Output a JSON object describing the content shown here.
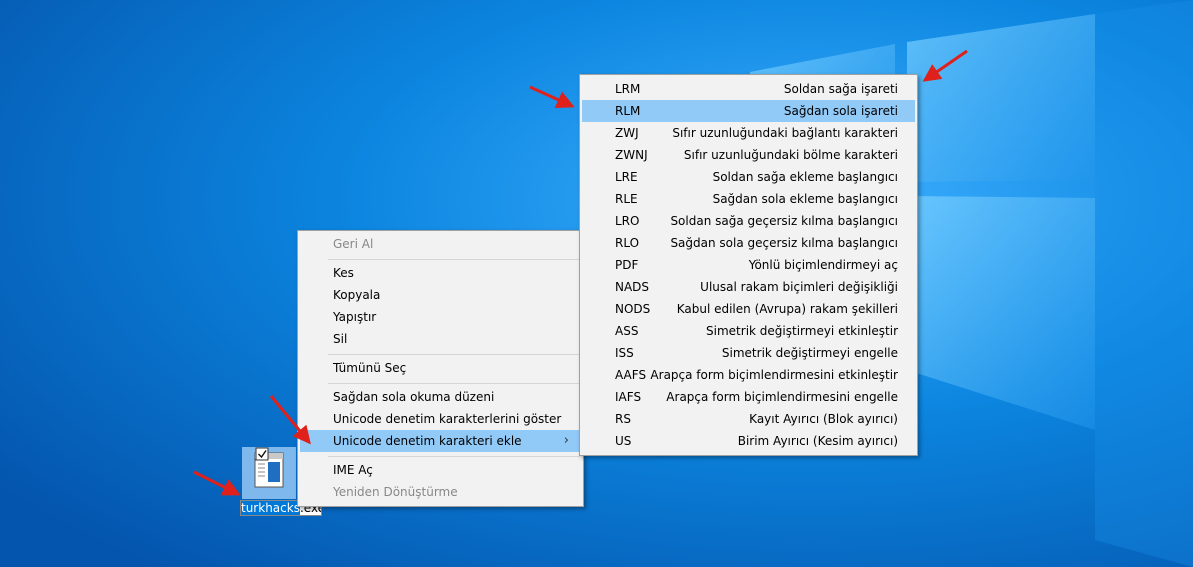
{
  "context_menu": {
    "undo": "Geri Al",
    "cut": "Kes",
    "copy": "Kopyala",
    "paste": "Yapıştır",
    "delete": "Sil",
    "select_all": "Tümünü Seç",
    "rtl_reading": "Sağdan sola okuma düzeni",
    "show_unicode": "Unicode denetim karakterlerini göster",
    "insert_unicode": "Unicode denetim karakteri ekle",
    "insert_unicode_arrow": "›",
    "ime_open": "IME Aç",
    "reconversion": "Yeniden Dönüştürme"
  },
  "submenu": {
    "items": [
      {
        "code": "LRM",
        "desc": "Soldan sağa işareti"
      },
      {
        "code": "RLM",
        "desc": "Sağdan sola işareti"
      },
      {
        "code": "ZWJ",
        "desc": "Sıfır uzunluğundaki bağlantı karakteri"
      },
      {
        "code": "ZWNJ",
        "desc": "Sıfır uzunluğundaki bölme karakteri"
      },
      {
        "code": "LRE",
        "desc": "Soldan sağa ekleme başlangıcı"
      },
      {
        "code": "RLE",
        "desc": "Sağdan sola ekleme başlangıcı"
      },
      {
        "code": "LRO",
        "desc": "Soldan sağa geçersiz kılma başlangıcı"
      },
      {
        "code": "RLO",
        "desc": "Sağdan sola geçersiz kılma başlangıcı"
      },
      {
        "code": "PDF",
        "desc": "Yönlü biçimlendirmeyi aç"
      },
      {
        "code": "NADS",
        "desc": "Ulusal rakam biçimleri değişikliği"
      },
      {
        "code": "NODS",
        "desc": "Kabul edilen (Avrupa) rakam şekilleri"
      },
      {
        "code": "ASS",
        "desc": "Simetrik değiştirmeyi etkinleştir"
      },
      {
        "code": "ISS",
        "desc": "Simetrik değiştirmeyi engelle"
      },
      {
        "code": "AAFS",
        "desc": "Arapça form biçimlendirmesini etkinleştir"
      },
      {
        "code": "IAFS",
        "desc": "Arapça form biçimlendirmesini engelle"
      },
      {
        "code": "RS",
        "desc": "Kayıt Ayırıcı (Blok ayırıcı)"
      },
      {
        "code": "US",
        "desc": "Birim Ayırıcı (Kesim ayırıcı)"
      }
    ]
  },
  "file": {
    "name_selected": "turkhacks",
    "name_ext": ".exe"
  },
  "colors": {
    "desktop_bg": "#0a7ad6",
    "highlight": "#91c9f7",
    "annotation_arrow": "#e0201b"
  }
}
